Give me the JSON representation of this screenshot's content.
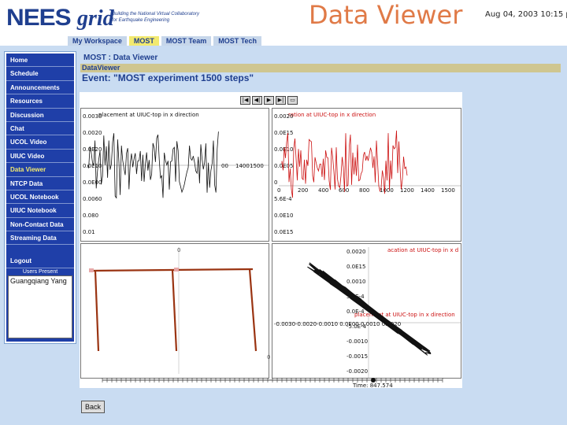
{
  "header": {
    "logo_nees": "NEES",
    "logo_grid": "grid",
    "logo_tagline_1": "Building the National Virtual Collaboratory",
    "logo_tagline_2": "for Earthquake Engineering",
    "slide_title": "Data Viewer",
    "datetime": "Aug 04, 2003 10:15 p"
  },
  "tabs": [
    {
      "label": "My Workspace",
      "active": false
    },
    {
      "label": "MOST",
      "active": true
    },
    {
      "label": "MOST Team",
      "active": false
    },
    {
      "label": "MOST Tech",
      "active": false
    }
  ],
  "nav": {
    "items": [
      {
        "label": "Home",
        "active": false
      },
      {
        "label": "Schedule",
        "active": false
      },
      {
        "label": "Announcements",
        "active": false
      },
      {
        "label": "Resources",
        "active": false
      },
      {
        "label": "Discussion",
        "active": false
      },
      {
        "label": "Chat",
        "active": false
      },
      {
        "label": "UCOL Video",
        "active": false
      },
      {
        "label": "UIUC Video",
        "active": false
      },
      {
        "label": "Data Viewer",
        "active": true
      },
      {
        "label": "NTCP Data",
        "active": false
      },
      {
        "label": "UCOL Notebook",
        "active": false
      },
      {
        "label": "UIUC Notebook",
        "active": false
      },
      {
        "label": "Non-Contact Data",
        "active": false
      },
      {
        "label": "Streaming Data",
        "active": false
      },
      {
        "label": "Logout",
        "active": false
      }
    ],
    "users_present_label": "Users Present",
    "users": [
      "Guangqiang Yang"
    ]
  },
  "main": {
    "breadcrumb": "MOST : Data Viewer",
    "section_bar": "DataViewer",
    "event_title": "Event: \"MOST experiment 1500 steps\"",
    "controls": [
      {
        "name": "rewind-button",
        "glyph": "|◀"
      },
      {
        "name": "step-back-button",
        "glyph": "◀|"
      },
      {
        "name": "play-button",
        "glyph": "▶"
      },
      {
        "name": "step-forward-button",
        "glyph": "▶|"
      },
      {
        "name": "export-button",
        "glyph": "▭"
      }
    ],
    "back_label": "Back"
  },
  "panels": {
    "top_left": {
      "title": "placement at UIUC-top in x direction",
      "color": "#111111",
      "ytick_labels": [
        "0.0030",
        "0.0020",
        "0.0E20",
        "0.0E10",
        "0.0E00",
        "0.0060",
        "0.080",
        "0.01"
      ],
      "xtick_labels": [
        "00",
        "1400",
        "1500"
      ]
    },
    "top_right": {
      "title": "ration at UIUC-top in x direction",
      "color": "#cc1111",
      "ytick_labels": [
        "0.0020",
        "0.0E15",
        "0.0E10",
        "0.0E05",
        "0",
        "5.6E-4",
        "0.0E10",
        "0.0E15"
      ],
      "xtick_labels": [
        "0",
        "200",
        "400",
        "600",
        "800",
        "1000",
        "1200",
        "1400",
        "1500"
      ]
    },
    "bottom_left": {
      "color": "#9a3412",
      "marker_labels": [
        "0",
        "0"
      ]
    },
    "bottom_right": {
      "title_top": "acation at UIUC-top in x d",
      "title_mid": "placement at UIUC-top in x direction",
      "ytick_labels": [
        "0.0020",
        "0.0E15",
        "0.0010",
        "5.0E-4",
        "0.0E-4",
        "-5.0E-4",
        "-0.0010",
        "-0.0015",
        "-0.0020"
      ],
      "xtick_labels": "-0.0030-0.0020-0.0010 0.0E00 0.0010 0.0020",
      "time_label": "Time: 847.574"
    },
    "timeline": {
      "time_label": "Time: 847.574"
    }
  }
}
